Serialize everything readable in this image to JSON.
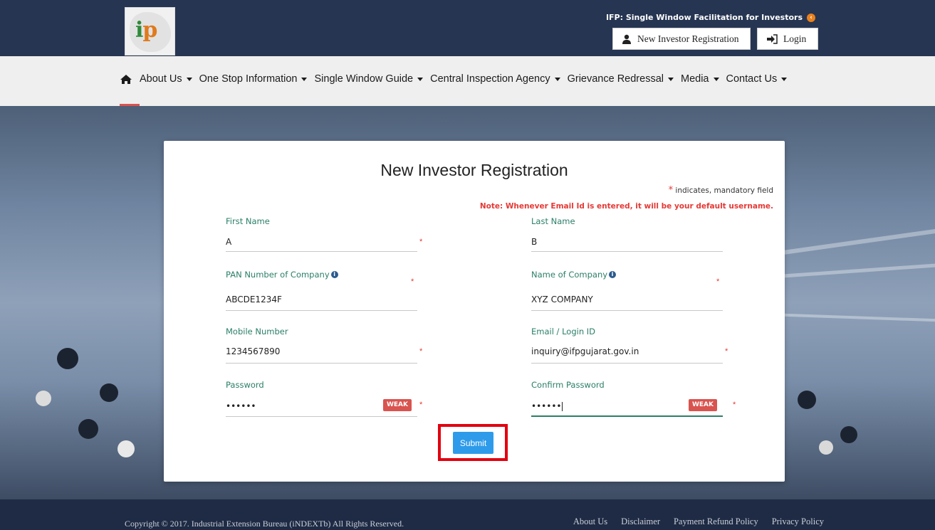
{
  "header": {
    "logo_text_i": "i",
    "logo_text_p": "p",
    "tagline": "IFP: Single Window Facilitation for Investors",
    "register_label": "New Investor Registration",
    "login_label": "Login"
  },
  "nav": {
    "items": [
      {
        "label": "About Us"
      },
      {
        "label": "One Stop Information"
      },
      {
        "label": "Single Window Guide"
      },
      {
        "label": "Central Inspection Agency"
      },
      {
        "label": "Grievance Redressal"
      },
      {
        "label": "Media"
      },
      {
        "label": "Contact Us"
      }
    ]
  },
  "form": {
    "title": "New Investor Registration",
    "mandatory_star": "*",
    "mandatory_text": "indicates, mandatory field",
    "note": "Note: Whenever Email Id is entered, it will be your default username.",
    "first_name": {
      "label": "First Name",
      "value": "A"
    },
    "last_name": {
      "label": "Last Name",
      "value": "B"
    },
    "pan": {
      "label": "PAN Number of Company",
      "value": "ABCDE1234F"
    },
    "company": {
      "label": "Name of Company",
      "value": "XYZ COMPANY"
    },
    "mobile": {
      "label": "Mobile Number",
      "value": "1234567890"
    },
    "email": {
      "label": "Email / Login ID",
      "value": "inquiry@ifpgujarat.gov.in"
    },
    "password": {
      "label": "Password",
      "value": "••••••",
      "strength": "WEAK"
    },
    "confirm_password": {
      "label": "Confirm Password",
      "value": "••••••",
      "strength": "WEAK"
    },
    "required_mark": "*",
    "submit_label": "Submit"
  },
  "footer": {
    "copyright": "Copyright © 2017. Industrial Extension Bureau (iNDEXTb) All Rights Reserved.",
    "links": [
      {
        "label": "About Us"
      },
      {
        "label": "Disclaimer"
      },
      {
        "label": "Payment Refund Policy"
      },
      {
        "label": "Privacy Policy"
      }
    ]
  }
}
